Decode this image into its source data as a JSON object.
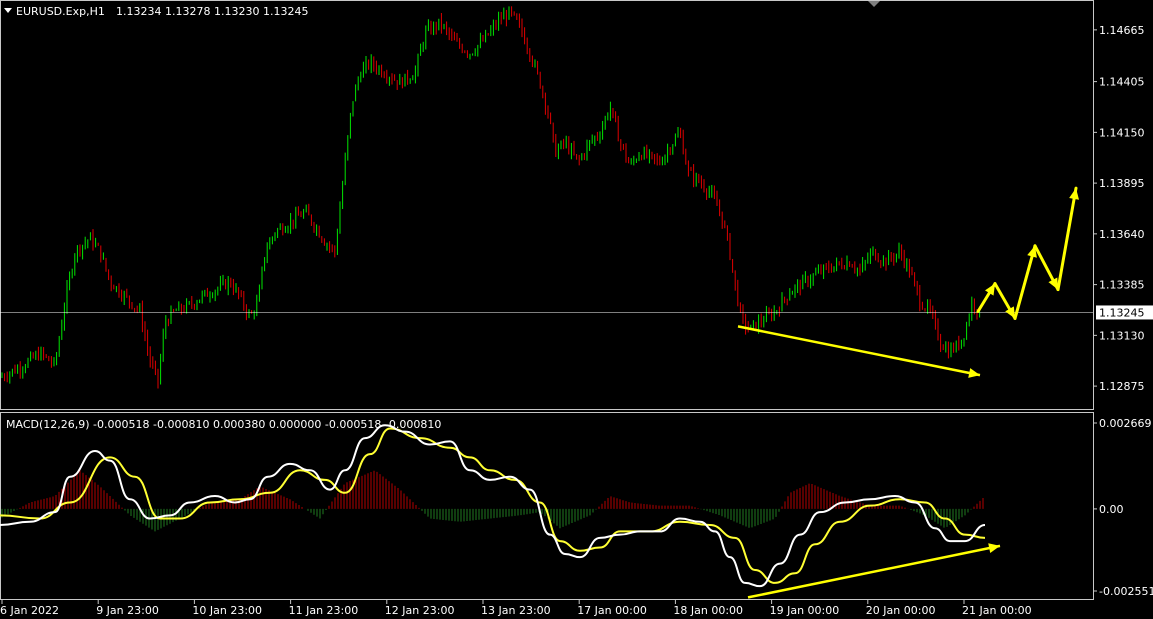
{
  "header": {
    "symbol": "EURUSD.Exp,H1",
    "ohlc": "1.13234 1.13278 1.13230 1.13245"
  },
  "colors": {
    "background": "#000000",
    "bull": "#00e600",
    "bear": "#e00000",
    "macd_line": "#ffffff",
    "signal_line": "#ffff33",
    "hist_pos": "#b30000",
    "hist_neg": "#1f7a1f",
    "annotation": "#ffff00",
    "grid": "#ffffff"
  },
  "chart_data": [
    {
      "type": "candlestick",
      "title": "EURUSD.Exp,H1",
      "ylim": [
        1.1277,
        1.148
      ],
      "yticks": [
        "1.14665",
        "1.14405",
        "1.14150",
        "1.13895",
        "1.13640",
        "1.13385",
        "1.13130",
        "1.12875"
      ],
      "current_price": 1.13245,
      "current_price_label": "1.13245",
      "x_labels": [
        "6 Jan 2022",
        "9 Jan 23:00",
        "10 Jan 23:00",
        "11 Jan 23:00",
        "12 Jan 23:00",
        "13 Jan 23:00",
        "17 Jan 00:00",
        "18 Jan 00:00",
        "19 Jan 00:00",
        "20 Jan 00:00",
        "21 Jan 00:00"
      ],
      "close_path": [
        [
          0,
          1.1292
        ],
        [
          20,
          1.1297
        ],
        [
          40,
          1.1304
        ],
        [
          55,
          1.1298
        ],
        [
          65,
          1.133
        ],
        [
          75,
          1.1355
        ],
        [
          90,
          1.1362
        ],
        [
          100,
          1.1355
        ],
        [
          110,
          1.134
        ],
        [
          120,
          1.1335
        ],
        [
          130,
          1.133
        ],
        [
          140,
          1.1325
        ],
        [
          150,
          1.13
        ],
        [
          158,
          1.129
        ],
        [
          165,
          1.132
        ],
        [
          175,
          1.1325
        ],
        [
          190,
          1.1328
        ],
        [
          200,
          1.1332
        ],
        [
          215,
          1.1336
        ],
        [
          230,
          1.134
        ],
        [
          240,
          1.1332
        ],
        [
          250,
          1.1322
        ],
        [
          258,
          1.133
        ],
        [
          265,
          1.1355
        ],
        [
          275,
          1.1365
        ],
        [
          290,
          1.137
        ],
        [
          305,
          1.1375
        ],
        [
          315,
          1.1368
        ],
        [
          325,
          1.136
        ],
        [
          335,
          1.1355
        ],
        [
          345,
          1.14
        ],
        [
          352,
          1.143
        ],
        [
          360,
          1.1445
        ],
        [
          370,
          1.145
        ],
        [
          385,
          1.1445
        ],
        [
          400,
          1.144
        ],
        [
          415,
          1.1445
        ],
        [
          425,
          1.1465
        ],
        [
          440,
          1.147
        ],
        [
          455,
          1.146
        ],
        [
          470,
          1.1455
        ],
        [
          485,
          1.1462
        ],
        [
          500,
          1.1472
        ],
        [
          510,
          1.1475
        ],
        [
          520,
          1.1468
        ],
        [
          530,
          1.1455
        ],
        [
          540,
          1.144
        ],
        [
          548,
          1.1425
        ],
        [
          555,
          1.1405
        ],
        [
          565,
          1.141
        ],
        [
          578,
          1.14
        ],
        [
          590,
          1.141
        ],
        [
          600,
          1.1415
        ],
        [
          610,
          1.1428
        ],
        [
          620,
          1.141
        ],
        [
          630,
          1.1398
        ],
        [
          640,
          1.1405
        ],
        [
          650,
          1.1402
        ],
        [
          660,
          1.14
        ],
        [
          670,
          1.1408
        ],
        [
          680,
          1.1415
        ],
        [
          688,
          1.1395
        ],
        [
          700,
          1.139
        ],
        [
          710,
          1.1385
        ],
        [
          720,
          1.1375
        ],
        [
          728,
          1.136
        ],
        [
          735,
          1.1338
        ],
        [
          742,
          1.132
        ],
        [
          750,
          1.1316
        ],
        [
          760,
          1.132
        ],
        [
          775,
          1.1325
        ],
        [
          790,
          1.1335
        ],
        [
          805,
          1.134
        ],
        [
          820,
          1.1345
        ],
        [
          835,
          1.1348
        ],
        [
          850,
          1.135
        ],
        [
          860,
          1.1345
        ],
        [
          872,
          1.1355
        ],
        [
          885,
          1.135
        ],
        [
          900,
          1.1355
        ],
        [
          910,
          1.1345
        ],
        [
          920,
          1.133
        ],
        [
          930,
          1.1325
        ],
        [
          940,
          1.131
        ],
        [
          948,
          1.1305
        ],
        [
          958,
          1.1308
        ],
        [
          965,
          1.1315
        ],
        [
          972,
          1.133
        ],
        [
          980,
          1.1324
        ]
      ],
      "annotations": {
        "divergence_line": [
          [
            738,
            1.13175
          ],
          [
            980,
            1.1293
          ]
        ],
        "forecast_path": [
          [
            978,
            1.1325
          ],
          [
            995,
            1.1339
          ],
          [
            1015,
            1.13215
          ],
          [
            1035,
            1.1358
          ],
          [
            1058,
            1.1336
          ],
          [
            1076,
            1.1387
          ]
        ]
      }
    },
    {
      "type": "macd",
      "title": "MACD(12,26,9) -0.000518 -0.000810 0.000380 0.000000 -0.000518 -0.000810",
      "ylim": [
        -0.002551,
        0.002669
      ],
      "yticks": [
        "0.002669",
        "0.00",
        "-0.002551"
      ],
      "macd_path": [
        [
          0,
          -0.0005
        ],
        [
          30,
          -0.0004
        ],
        [
          55,
          -0.0001
        ],
        [
          70,
          0.001
        ],
        [
          95,
          0.0018
        ],
        [
          110,
          0.0015
        ],
        [
          130,
          0.0003
        ],
        [
          150,
          -0.0003
        ],
        [
          170,
          -0.0002
        ],
        [
          190,
          0.0002
        ],
        [
          215,
          0.0004
        ],
        [
          235,
          0.0002
        ],
        [
          250,
          0.0003
        ],
        [
          268,
          0.001
        ],
        [
          290,
          0.0014
        ],
        [
          310,
          0.0012
        ],
        [
          330,
          0.0006
        ],
        [
          345,
          0.0012
        ],
        [
          365,
          0.0022
        ],
        [
          385,
          0.0026
        ],
        [
          405,
          0.0024
        ],
        [
          430,
          0.002
        ],
        [
          450,
          0.0021
        ],
        [
          470,
          0.0012
        ],
        [
          490,
          0.0009
        ],
        [
          510,
          0.001
        ],
        [
          530,
          0.0006
        ],
        [
          550,
          -0.0008
        ],
        [
          565,
          -0.0014
        ],
        [
          580,
          -0.0015
        ],
        [
          600,
          -0.0009
        ],
        [
          620,
          -0.0008
        ],
        [
          640,
          -0.0007
        ],
        [
          660,
          -0.0007
        ],
        [
          680,
          -0.0003
        ],
        [
          700,
          -0.0004
        ],
        [
          715,
          -0.0007
        ],
        [
          730,
          -0.0015
        ],
        [
          745,
          -0.0023
        ],
        [
          760,
          -0.0024
        ],
        [
          780,
          -0.0017
        ],
        [
          800,
          -0.0008
        ],
        [
          820,
          -0.0001
        ],
        [
          845,
          0.0002
        ],
        [
          870,
          0.0003
        ],
        [
          895,
          0.0004
        ],
        [
          915,
          0.0002
        ],
        [
          935,
          -0.0006
        ],
        [
          950,
          -0.001
        ],
        [
          965,
          -0.001
        ],
        [
          985,
          -0.0005
        ]
      ],
      "signal_path": [
        [
          0,
          -0.0002
        ],
        [
          40,
          -0.0003
        ],
        [
          70,
          0.0002
        ],
        [
          110,
          0.0016
        ],
        [
          135,
          0.001
        ],
        [
          160,
          -0.0003
        ],
        [
          180,
          -0.0003
        ],
        [
          210,
          0.0002
        ],
        [
          240,
          0.0003
        ],
        [
          270,
          0.0005
        ],
        [
          300,
          0.0012
        ],
        [
          325,
          0.0009
        ],
        [
          345,
          0.0005
        ],
        [
          370,
          0.0017
        ],
        [
          390,
          0.0025
        ],
        [
          420,
          0.0022
        ],
        [
          450,
          0.0019
        ],
        [
          470,
          0.0016
        ],
        [
          490,
          0.0012
        ],
        [
          515,
          0.0009
        ],
        [
          540,
          0.0002
        ],
        [
          560,
          -0.001
        ],
        [
          580,
          -0.0013
        ],
        [
          600,
          -0.0012
        ],
        [
          620,
          -0.0007
        ],
        [
          650,
          -0.0007
        ],
        [
          680,
          -0.0004
        ],
        [
          710,
          -0.0005
        ],
        [
          735,
          -0.0009
        ],
        [
          755,
          -0.0019
        ],
        [
          775,
          -0.0023
        ],
        [
          795,
          -0.002
        ],
        [
          815,
          -0.0011
        ],
        [
          840,
          -0.0004
        ],
        [
          870,
          0.0001
        ],
        [
          900,
          0.0003
        ],
        [
          925,
          0.0002
        ],
        [
          945,
          -0.0003
        ],
        [
          965,
          -0.0008
        ],
        [
          985,
          -0.0009
        ]
      ],
      "hist_path": [
        [
          0,
          -0.0003
        ],
        [
          30,
          0.0002
        ],
        [
          55,
          0.0004
        ],
        [
          80,
          0.0012
        ],
        [
          100,
          0.0007
        ],
        [
          130,
          -0.0002
        ],
        [
          155,
          -0.0007
        ],
        [
          180,
          -0.0003
        ],
        [
          210,
          0.0002
        ],
        [
          240,
          0.0003
        ],
        [
          260,
          0.0007
        ],
        [
          290,
          0.0003
        ],
        [
          320,
          -0.0003
        ],
        [
          345,
          0.0008
        ],
        [
          375,
          0.0012
        ],
        [
          400,
          0.0006
        ],
        [
          430,
          -0.0003
        ],
        [
          460,
          -0.0004
        ],
        [
          490,
          -0.0003
        ],
        [
          520,
          -0.0002
        ],
        [
          540,
          -0.0001
        ],
        [
          560,
          -0.0006
        ],
        [
          590,
          -0.0002
        ],
        [
          610,
          0.0004
        ],
        [
          630,
          0.0002
        ],
        [
          660,
          0.0001
        ],
        [
          690,
          0.0001
        ],
        [
          720,
          -0.0002
        ],
        [
          750,
          -0.0006
        ],
        [
          775,
          -0.0003
        ],
        [
          790,
          0.0005
        ],
        [
          810,
          0.0008
        ],
        [
          840,
          0.0004
        ],
        [
          870,
          0.0001
        ],
        [
          900,
          0.0001
        ],
        [
          925,
          -0.0002
        ],
        [
          945,
          -0.0006
        ],
        [
          965,
          -0.0002
        ],
        [
          985,
          0.0004
        ]
      ],
      "annotations": {
        "divergence_line": [
          [
            748,
            -0.00275
          ],
          [
            1000,
            -0.00115
          ]
        ]
      }
    }
  ]
}
